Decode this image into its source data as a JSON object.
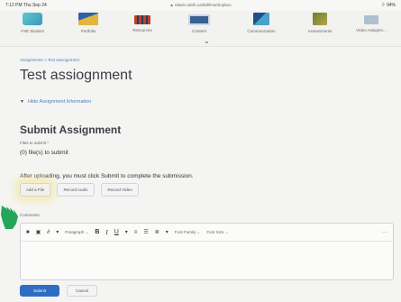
{
  "status_bar": {
    "time": "7:12 PM",
    "date": "Thu Sep 24",
    "url": "▲ elearn.uleth.ca/d2l/lms/dropbox",
    "battery": "⌔ 94%"
  },
  "nav": {
    "items": [
      {
        "label": "FSE Student",
        "color": "#4bb8c8"
      },
      {
        "label": "Portfolio",
        "color": "#3f7ac2"
      },
      {
        "label": "Resources",
        "color": "#b8412f"
      },
      {
        "label": "Content",
        "color": "#3a5f94"
      },
      {
        "label": "Communication",
        "color": "#3a8ab5"
      },
      {
        "label": "Assessments",
        "color": "#7b8c3a"
      },
      {
        "label": "Video Assignm...",
        "color": "#8ba4c0"
      }
    ],
    "chevron": "⌄"
  },
  "breadcrumb": "Assignments > Test assiognment",
  "page_title": "Test assiognment",
  "hide_info": {
    "arrow": "▼",
    "label": "Hide Assignment Information"
  },
  "submit_section": {
    "title": "Submit Assignment",
    "files_label": "Files to submit *",
    "files_count": "(0) file(s) to submit",
    "after_upload_text": "After uploading, you must click Submit to complete the submission.",
    "buttons": {
      "add_file": "Add a File",
      "record_audio": "Record Audio",
      "record_video": "Record Video"
    }
  },
  "comments": {
    "label": "Comments",
    "toolbar": {
      "paragraph": "Paragraph",
      "font_family": "Font Family",
      "font_size": "Font Size",
      "more": "···"
    }
  },
  "footer": {
    "submit": "Submit",
    "cancel": "Cancel"
  },
  "colors": {
    "primary": "#2f6dc2",
    "link": "#4a7ebf",
    "highlight": "#f6e9aa",
    "hand": "#23a65a"
  }
}
